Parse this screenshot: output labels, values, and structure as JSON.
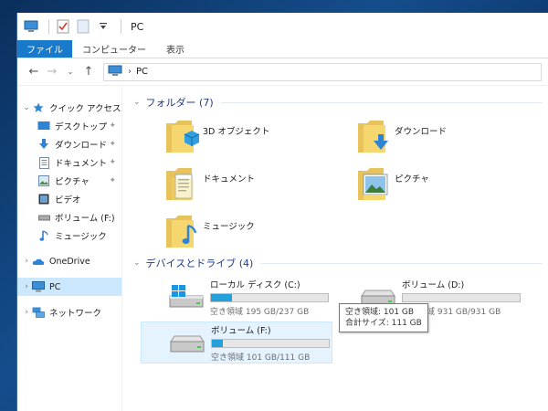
{
  "window": {
    "title": "PC"
  },
  "ribbon": {
    "tabs": [
      {
        "label": "ファイル",
        "active": true
      },
      {
        "label": "コンピューター"
      },
      {
        "label": "表示"
      }
    ]
  },
  "address": {
    "path": "PC"
  },
  "nav": {
    "quick_access": "クイック アクセス",
    "items": [
      {
        "label": "デスクトップ",
        "icon": "desktop-icon",
        "pinned": true
      },
      {
        "label": "ダウンロード",
        "icon": "download-icon",
        "pinned": true
      },
      {
        "label": "ドキュメント",
        "icon": "document-icon",
        "pinned": true
      },
      {
        "label": "ピクチャ",
        "icon": "pictures-icon",
        "pinned": true
      },
      {
        "label": "ビデオ",
        "icon": "video-icon"
      },
      {
        "label": "ボリューム (F:)",
        "icon": "drive-icon"
      },
      {
        "label": "ミュージック",
        "icon": "music-icon"
      }
    ],
    "onedrive": "OneDrive",
    "pc": "PC",
    "network": "ネットワーク"
  },
  "folders": {
    "header": "フォルダー (7)",
    "items": [
      {
        "label": "3D オブジェクト",
        "overlay": "3d-objects-icon"
      },
      {
        "label": "ダウンロード",
        "overlay": "download-icon"
      },
      {
        "label": "ドキュメント",
        "overlay": "document-icon"
      },
      {
        "label": "ピクチャ",
        "overlay": "pictures-icon"
      },
      {
        "label": "ミュージック",
        "overlay": "music-icon"
      }
    ]
  },
  "drives": {
    "header": "デバイスとドライブ (4)",
    "items": [
      {
        "name": "ローカル ディスク (C:)",
        "free": "空き領域 195 GB/237 GB",
        "used_fraction": 0.18,
        "type": "system"
      },
      {
        "name": "ボリューム (D:)",
        "free": "空き領域 931 GB/931 GB",
        "used_fraction": 0.0,
        "type": "hdd"
      },
      {
        "name": "ボリューム (F:)",
        "free": "空き領域 101 GB/111 GB",
        "used_fraction": 0.09,
        "type": "hdd",
        "hover": true
      }
    ]
  },
  "tooltip": {
    "line1": "空き領域: 101 GB",
    "line2": "合計サイズ: 111 GB"
  },
  "colors": {
    "accent": "#1979ca",
    "bar_fill": "#26a0da",
    "header_text": "#1e3a87",
    "selected_bg": "#cce8ff"
  }
}
